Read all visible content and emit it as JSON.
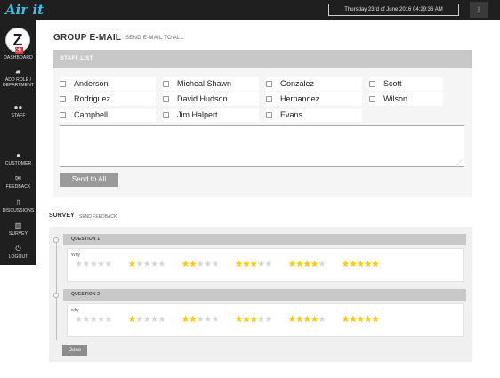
{
  "topbar": {
    "logo_text": "Air it",
    "datetime": "Thursday 23rd of June 2016 04:29:36 AM",
    "menu_icon": "vertical-dots-icon"
  },
  "sidebar": {
    "avatar_letter": "Z",
    "avatar_badge": "+",
    "items": [
      {
        "label": "DASHBOARD",
        "icon": "monitor-icon",
        "glyph": "▭"
      },
      {
        "label": "ADD ROLE / DEPARTMENT",
        "icon": "folder-icon",
        "glyph": "▰"
      },
      {
        "label": "STAFF",
        "icon": "users-icon",
        "glyph": "●●"
      },
      {
        "label": "CUSTOMER",
        "icon": "user-icon",
        "glyph": "●"
      },
      {
        "label": "FEEDBACK",
        "icon": "envelope-icon",
        "glyph": "✉"
      },
      {
        "label": "DISCUSSIONS",
        "icon": "file-icon",
        "glyph": "▯"
      },
      {
        "label": "SURVEY",
        "icon": "chart-icon",
        "glyph": "▥"
      },
      {
        "label": "LOGOUT",
        "icon": "power-icon",
        "glyph": "⏻"
      }
    ]
  },
  "page": {
    "title": "GROUP E-MAIL",
    "subtitle": "SEND E-MAIL TO ALL"
  },
  "staff_list": {
    "header": "STAFF LIST",
    "staff": [
      "Anderson",
      "Micheal Shawn",
      "Gonzalez",
      "Scott",
      "Rodriguez",
      "David Hudson",
      "Hernandez",
      "Wilson",
      "Campbell",
      "Jim Halpert",
      "Evans"
    ],
    "message_value": "",
    "send_label": "Send to All"
  },
  "survey": {
    "title": "SURVEY",
    "subtitle": "SEND FEEDBACK",
    "questions": [
      {
        "label": "QUESTION 1",
        "why": "Why",
        "options": [
          0,
          1,
          2,
          3,
          4,
          5
        ]
      },
      {
        "label": "QUESTION 2",
        "why": "why",
        "options": [
          0,
          1,
          2,
          3,
          4,
          5
        ]
      }
    ],
    "stars_max": 5,
    "done_label": "Done"
  },
  "colors": {
    "topbar": "#1f1f1f",
    "accent": "#39c3f0",
    "star_on": "#ffcc00",
    "star_off": "#d6d6d6",
    "panel_header": "#c8c8c8"
  }
}
